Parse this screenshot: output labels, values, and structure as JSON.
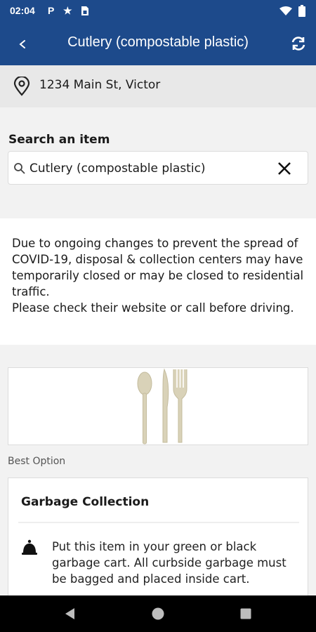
{
  "status_bar": {
    "time": "02:04",
    "icons": [
      "parking-icon",
      "star-icon",
      "sim-icon",
      "wifi-icon",
      "battery-icon"
    ]
  },
  "app_bar": {
    "title": "Cutlery (compostable plastic)",
    "back_icon": "chevron-left-icon",
    "refresh_icon": "refresh-icon"
  },
  "location": {
    "address": "1234 Main St, Victor",
    "icon": "map-pin-icon"
  },
  "search": {
    "label": "Search an item",
    "value": "Cutlery (compostable plastic)",
    "icon": "search-icon",
    "clear_icon": "close-icon"
  },
  "notice": {
    "text": "Due to ongoing changes to prevent the spread of COVID-19, disposal & collection centers may have temporarily closed or may be closed to residential traffic.\nPlease check their website or call before driving."
  },
  "item_image": {
    "alt_icon": "cutlery-icon",
    "color": "#d9d2b8"
  },
  "best_option": {
    "label": "Best Option"
  },
  "option_card": {
    "title": "Garbage Collection",
    "icon": "garbage-bell-icon",
    "description": "Put this item in your green or black garbage cart. All curbside garbage must be bagged and placed inside cart."
  },
  "nav_bar": {
    "buttons": [
      "back-triangle-icon",
      "home-circle-icon",
      "recents-square-icon"
    ]
  },
  "colors": {
    "primary": "#1d4a8b",
    "background": "#f2f2f2"
  }
}
